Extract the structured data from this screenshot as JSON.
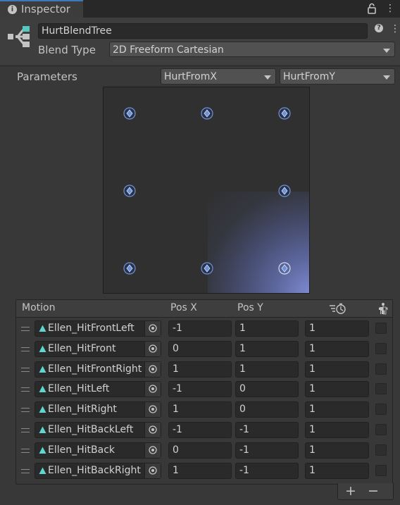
{
  "window": {
    "tab_title": "Inspector"
  },
  "blend_tree": {
    "name": "HurtBlendTree",
    "blend_type_label": "Blend Type",
    "blend_type_value": "2D Freeform Cartesian"
  },
  "parameters": {
    "label": "Parameters",
    "param_x": "HurtFromX",
    "param_y": "HurtFromY"
  },
  "motion_table": {
    "headers": {
      "motion": "Motion",
      "pos_x": "Pos X",
      "pos_y": "Pos Y"
    },
    "rows": [
      {
        "motion": "Ellen_HitFrontLeft",
        "pos_x": "-1",
        "pos_y": "1",
        "speed": "1"
      },
      {
        "motion": "Ellen_HitFront",
        "pos_x": "0",
        "pos_y": "1",
        "speed": "1"
      },
      {
        "motion": "Ellen_HitFrontRight",
        "pos_x": "1",
        "pos_y": "1",
        "speed": "1"
      },
      {
        "motion": "Ellen_HitLeft",
        "pos_x": "-1",
        "pos_y": "0",
        "speed": "1"
      },
      {
        "motion": "Ellen_HitRight",
        "pos_x": "1",
        "pos_y": "0",
        "speed": "1"
      },
      {
        "motion": "Ellen_HitBackLeft",
        "pos_x": "-1",
        "pos_y": "-1",
        "speed": "1"
      },
      {
        "motion": "Ellen_HitBack",
        "pos_x": "0",
        "pos_y": "-1",
        "speed": "1"
      },
      {
        "motion": "Ellen_HitBackRight",
        "pos_x": "1",
        "pos_y": "-1",
        "speed": "1"
      }
    ],
    "footer": {
      "add_label": "+",
      "remove_label": "−"
    }
  },
  "graph": {
    "points": [
      {
        "x": -1,
        "y": 1
      },
      {
        "x": 0,
        "y": 1
      },
      {
        "x": 1,
        "y": 1
      },
      {
        "x": -1,
        "y": 0
      },
      {
        "x": 1,
        "y": 0
      },
      {
        "x": -1,
        "y": -1
      },
      {
        "x": 0,
        "y": -1
      },
      {
        "x": 1,
        "y": -1
      }
    ],
    "selected_index": 7
  },
  "colors": {
    "accent": "#3a79bb",
    "node_fill": "#6f93d8",
    "blend_glow": "#7e8bd2"
  },
  "icons": {
    "tab": "info-icon",
    "blend_tree": "blend-tree-icon",
    "motion": "animation-clip-icon",
    "picker": "object-picker-icon"
  }
}
